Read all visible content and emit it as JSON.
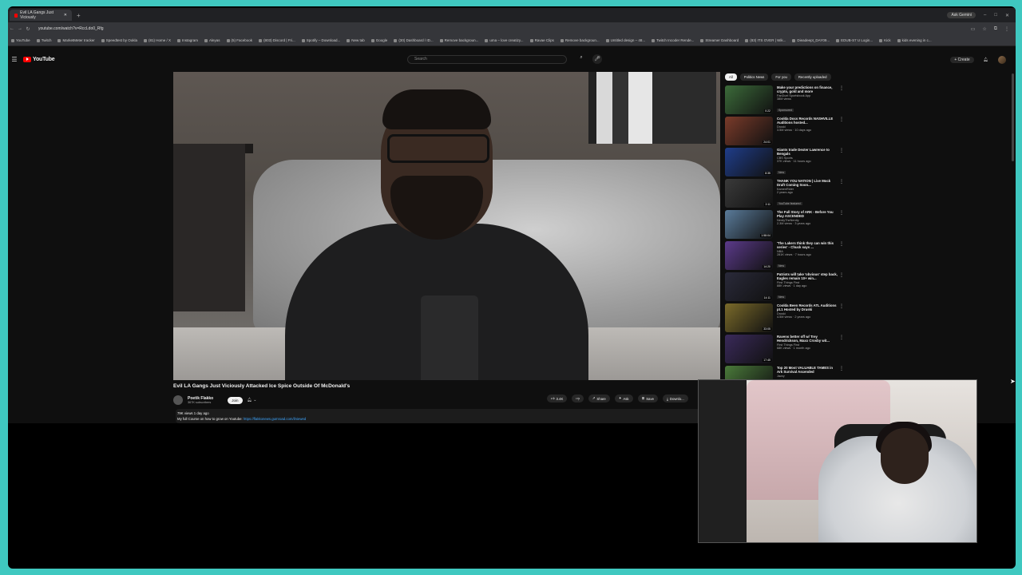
{
  "browser": {
    "tab_title": "Evil LA Gangs Just Viciously",
    "new_tab": "+",
    "profile": "Ask Gemini",
    "url": "youtube.com/watch?v=RccLdo0_Rfg",
    "bookmarks": [
      "YouTube",
      "Twitch",
      "MarketMeter tracker",
      "Speedtest by Ookla",
      "(81) Home / X",
      "Instagram",
      "Aleyas",
      "(5) Facebook",
      "(803) Discord | Fri...",
      "Spotify – Download...",
      "New tab",
      "Google",
      "(30) Dashboard / ID...",
      "Remove backgroun...",
      "uma – love creatizy...",
      "Ravae Clips",
      "Remove backgroun...",
      "Untitled design – 48...",
      "Twitch Incoder Rende...",
      "Streamer Dashboard",
      "(83) ITS OVER | Wik...",
      "Dieadeept_DAY09...",
      "EDUB-S7 U Login...",
      "Kick",
      "kids evening in c..."
    ]
  },
  "header": {
    "logo": "YouTube",
    "search_placeholder": "Search",
    "create": "Create"
  },
  "video": {
    "title": "Evil LA Gangs Just Viciously Attacked Ice Spice Outside Of McDonald's",
    "channel": "Poetik Flakko",
    "subscribers": "367K subscribers",
    "join": "Join",
    "likes": "3.4K",
    "share": "Share",
    "ask": "Ask",
    "save": "Save",
    "download": "Downlo...",
    "stats": "79K views  1 day ago",
    "description_prefix": "My full Course on how to grow on Youtube: ",
    "description_link": "https://flakkonews.gumroad.com/l/viewed"
  },
  "sidebar": {
    "chips": [
      "All",
      "Politics News",
      "For you",
      "Recently uploaded"
    ],
    "recs": [
      {
        "title": "Make your predictions on finance, crypto, gold and more",
        "channel": "FanDuel Sportsbook App",
        "meta": "38M views",
        "badge": "Sponsored",
        "duration": "0:22",
        "color": "#3c6b3a"
      },
      {
        "title": "Coolda Docs Records NASHVILLE Auditions hosted...",
        "channel": "Druski",
        "meta": "3.5M views · 10 days ago",
        "badge": "",
        "duration": "24:01",
        "color": "#7a3b2a"
      },
      {
        "title": "Giants trade Dexter Lawrence to Bengals",
        "channel": "CBS Sports",
        "meta": "37K views · 11 hours ago",
        "badge": "New",
        "duration": "8:35",
        "color": "#1f3d8a"
      },
      {
        "title": "THANK YOU NATION | Live Mock Draft Coming Soon...",
        "channel": "KamenRider",
        "meta": "2 years ago",
        "badge": "YouTube featured",
        "duration": "2:11",
        "color": "#3a3a3a"
      },
      {
        "title": "The Full Story of ARK - Before You Play ASCENDED",
        "channel": "NerdyTheNerdly",
        "meta": "2.3M views · 3 years ago",
        "badge": "",
        "duration": "1:58:04",
        "color": "#5a7b9a"
      },
      {
        "title": "'The Lakers think they can win this series' - Chuck says ...",
        "channel": "NBA",
        "meta": "281K views · 7 hours ago",
        "badge": "New",
        "duration": "14:20",
        "color": "#5b3a8a"
      },
      {
        "title": "Patriots will take 'obvious' step back, Eagles remain 10+ win...",
        "channel": "First Things First",
        "meta": "88K views · 1 day ago",
        "badge": "New",
        "duration": "14:11",
        "color": "#2a2a3a"
      },
      {
        "title": "Coolda Been Records ATL Auditions pt.1 Hosted by Druski",
        "channel": "Druski",
        "meta": "4.5M views · 2 years ago",
        "badge": "",
        "duration": "33:05",
        "color": "#7a6a2a"
      },
      {
        "title": "Ravens better off w/ Trey Hendrickson, Maxx Crosby wit...",
        "channel": "First Things First",
        "meta": "68K views · 1 month ago",
        "badge": "",
        "duration": "17:45",
        "color": "#3a2a5a"
      },
      {
        "title": "Top 20 Most VALUABLE TAMES in Ark Survival Ascended",
        "channel": "Jazzy",
        "meta": "",
        "badge": "",
        "duration": "",
        "color": "#4a7a3a"
      }
    ]
  }
}
